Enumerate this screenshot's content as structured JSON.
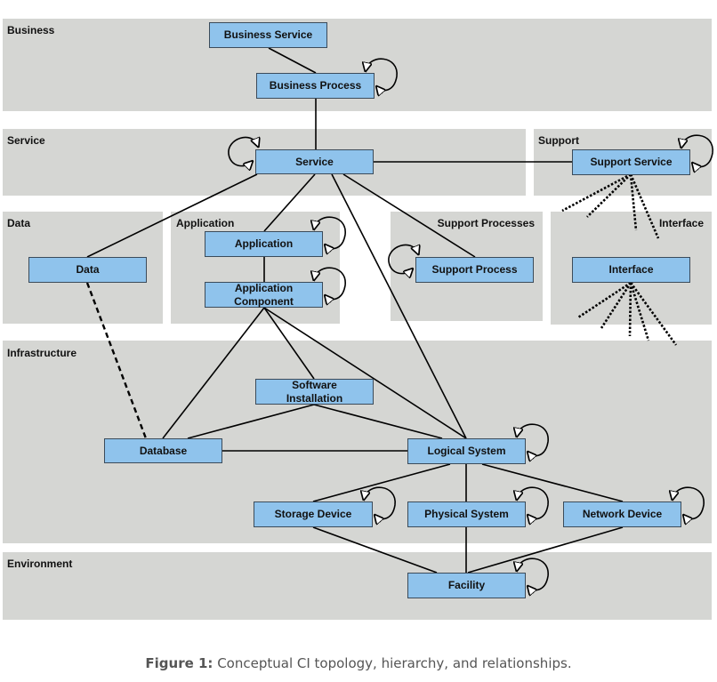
{
  "zones": {
    "business": "Business",
    "service": "Service",
    "support": "Support",
    "data": "Data",
    "application": "Application",
    "support_processes": "Support Processes",
    "interface": "Interface",
    "infrastructure": "Infrastructure",
    "environment": "Environment"
  },
  "nodes": {
    "business_service": "Business Service",
    "business_process": "Business Process",
    "service": "Service",
    "support_service": "Support Service",
    "data": "Data",
    "application": "Application",
    "application_component": "Application Component",
    "support_process": "Support Process",
    "interface": "Interface",
    "software_installation": "Software Installation",
    "database": "Database",
    "logical_system": "Logical System",
    "storage_device": "Storage Device",
    "physical_system": "Physical System",
    "network_device": "Network Device",
    "facility": "Facility"
  },
  "edges": [
    {
      "from": "business_service",
      "to": "business_process",
      "style": "solid"
    },
    {
      "from": "business_process",
      "to": "service",
      "style": "solid"
    },
    {
      "from": "service",
      "to": "support_service",
      "style": "solid"
    },
    {
      "from": "service",
      "to": "data",
      "style": "solid"
    },
    {
      "from": "service",
      "to": "application",
      "style": "solid"
    },
    {
      "from": "service",
      "to": "support_process",
      "style": "solid"
    },
    {
      "from": "service",
      "to": "logical_system",
      "style": "solid"
    },
    {
      "from": "application",
      "to": "application_component",
      "style": "solid"
    },
    {
      "from": "data",
      "to": "database",
      "style": "dashed"
    },
    {
      "from": "application_component",
      "to": "database",
      "style": "solid"
    },
    {
      "from": "application_component",
      "to": "software_installation",
      "style": "solid"
    },
    {
      "from": "application_component",
      "to": "logical_system",
      "style": "solid"
    },
    {
      "from": "software_installation",
      "to": "database",
      "style": "solid"
    },
    {
      "from": "software_installation",
      "to": "logical_system",
      "style": "solid"
    },
    {
      "from": "database",
      "to": "logical_system",
      "style": "solid"
    },
    {
      "from": "logical_system",
      "to": "storage_device",
      "style": "solid"
    },
    {
      "from": "logical_system",
      "to": "physical_system",
      "style": "solid"
    },
    {
      "from": "logical_system",
      "to": "network_device",
      "style": "solid"
    },
    {
      "from": "storage_device",
      "to": "facility",
      "style": "solid"
    },
    {
      "from": "physical_system",
      "to": "facility",
      "style": "solid"
    },
    {
      "from": "network_device",
      "to": "facility",
      "style": "solid"
    }
  ],
  "self_loops": [
    "business_process",
    "service",
    "support_service",
    "application",
    "application_component",
    "support_process",
    "logical_system",
    "storage_device",
    "physical_system",
    "network_device",
    "facility"
  ],
  "fan_outs": {
    "support_service": 4,
    "interface": 5
  },
  "caption": {
    "label": "Figure 1:",
    "text": " Conceptual CI topology, hierarchy, and relationships."
  }
}
